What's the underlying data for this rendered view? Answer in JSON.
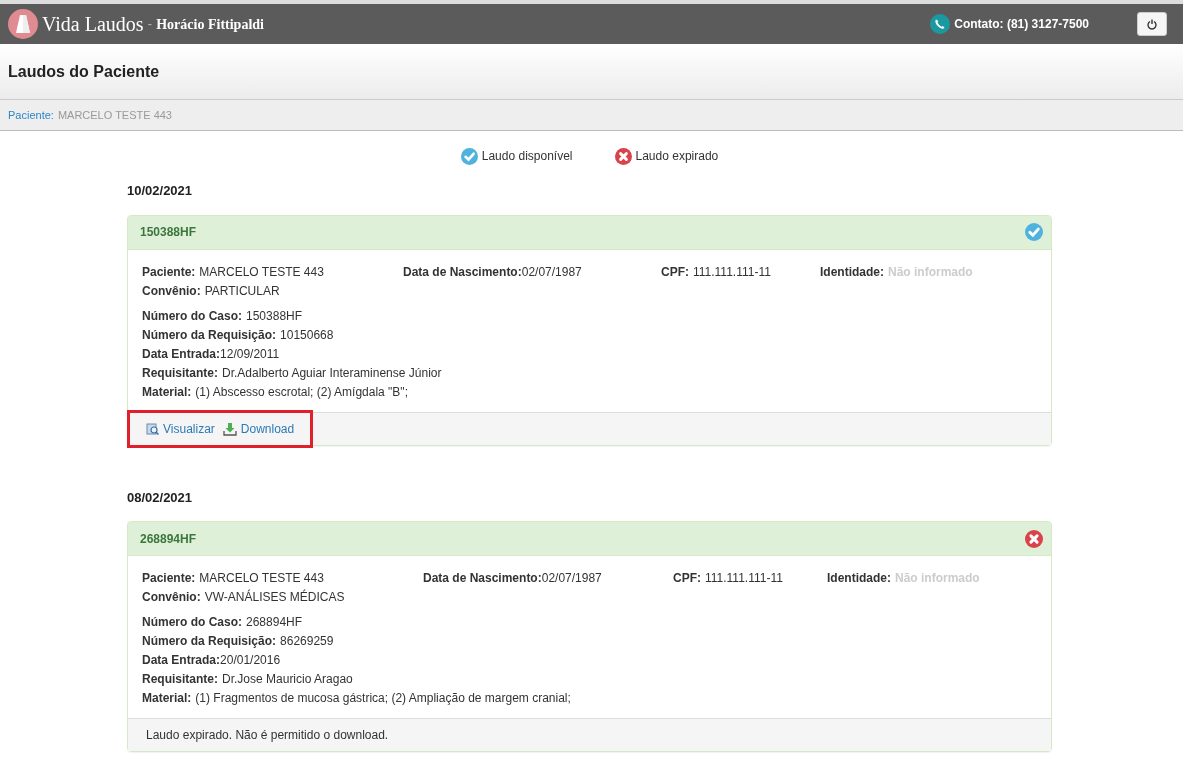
{
  "header": {
    "brand": "Vida Laudos",
    "separator": "-",
    "user": "Horácio Fittipaldi",
    "contact": "Contato: (81) 3127-7500"
  },
  "page_title": "Laudos do Paciente",
  "breadcrumb": {
    "label": "Paciente:",
    "value": "MARCELO TESTE 443"
  },
  "legend": [
    {
      "kind": "available",
      "label": "Laudo disponível"
    },
    {
      "kind": "expired",
      "label": "Laudo expirado"
    }
  ],
  "groups": [
    {
      "date": "10/02/2021",
      "reports": [
        {
          "code": "150388HF",
          "kind": "available",
          "highlighted": true,
          "summary": [
            {
              "label": "Paciente:",
              "value": "MARCELO TESTE 443",
              "missing": false
            },
            {
              "label": "Data de Nascimento:",
              "value": "02/07/1987",
              "missing": false
            },
            {
              "label": "CPF:",
              "value": "111.111.111-11",
              "missing": false
            },
            {
              "label": "Identidade:",
              "value": "Não informado",
              "missing": true
            }
          ],
          "convenio": {
            "label": "Convênio:",
            "value": "PARTICULAR"
          },
          "details": [
            {
              "label": "Número do Caso:",
              "value": "150388HF"
            },
            {
              "label": "Número da Requisição:",
              "value": "10150668"
            },
            {
              "label": "Data Entrada:",
              "value": "12/09/2011"
            },
            {
              "label": "Requisitante:",
              "value": "Dr.Adalberto Aguiar Interaminense Júnior"
            },
            {
              "label": "Material:",
              "value": "(1) Abscesso escrotal; (2) Amígdala \"B\";"
            }
          ],
          "actions": [
            {
              "kind": "view",
              "label": "Visualizar"
            },
            {
              "kind": "download",
              "label": "Download"
            }
          ]
        }
      ]
    },
    {
      "date": "08/02/2021",
      "reports": [
        {
          "code": "268894HF",
          "kind": "expired",
          "highlighted": false,
          "summary": [
            {
              "label": "Paciente:",
              "value": "MARCELO TESTE 443",
              "missing": false
            },
            {
              "label": "Data de Nascimento:",
              "value": "02/07/1987",
              "missing": false
            },
            {
              "label": "CPF:",
              "value": "111.111.111-11",
              "missing": false
            },
            {
              "label": "Identidade:",
              "value": "Não informado",
              "missing": true
            }
          ],
          "convenio": {
            "label": "Convênio:",
            "value": "VW-ANÁLISES MÉDICAS"
          },
          "details": [
            {
              "label": "Número do Caso:",
              "value": "268894HF"
            },
            {
              "label": "Número da Requisição:",
              "value": "86269259"
            },
            {
              "label": "Data Entrada:",
              "value": "20/01/2016"
            },
            {
              "label": "Requisitante:",
              "value": "Dr.Jose Mauricio Aragao"
            },
            {
              "label": "Material:",
              "value": "(1) Fragmentos de mucosa gástrica; (2) Ampliação de margem cranial;"
            }
          ],
          "message": "Laudo expirado. Não é permitido o download."
        }
      ]
    }
  ]
}
